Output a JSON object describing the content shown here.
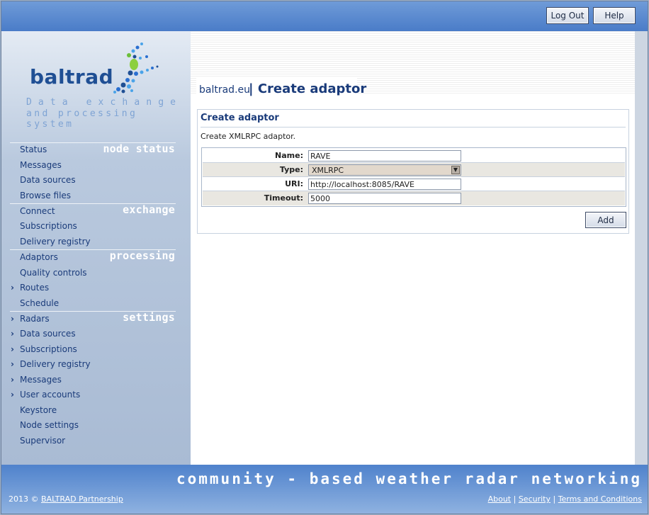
{
  "header": {
    "logout_label": "Log Out",
    "help_label": "Help"
  },
  "brand": {
    "name": "baltrad",
    "tagline_line1": "Data exchange",
    "tagline_line2": "and processing system"
  },
  "sidebar": {
    "sections": [
      {
        "title": "node status",
        "items": [
          "Status",
          "Messages",
          "Data sources",
          "Browse files"
        ]
      },
      {
        "title": "exchange",
        "items": [
          "Connect",
          "Subscriptions",
          "Delivery registry"
        ]
      },
      {
        "title": "processing",
        "items": [
          "Adaptors",
          "Quality controls",
          "Routes",
          "Schedule"
        ]
      },
      {
        "title": "settings",
        "items": [
          "Radars",
          "Data sources",
          "Subscriptions",
          "Delivery registry",
          "Messages",
          "User accounts",
          "Keystore",
          "Node settings",
          "Supervisor"
        ]
      }
    ]
  },
  "page": {
    "breadcrumb": "baltrad.eu",
    "title": "| Create adaptor"
  },
  "form": {
    "panel_title": "Create adaptor",
    "description": "Create XMLRPC adaptor.",
    "name_label": "Name:",
    "name_value": "RAVE",
    "type_label": "Type:",
    "type_value": "XMLRPC",
    "uri_label": "URI:",
    "uri_value": "http://localhost:8085/RAVE",
    "timeout_label": "Timeout:",
    "timeout_value": "5000",
    "add_label": "Add"
  },
  "footer": {
    "tagline": "community - based weather radar networking",
    "copyright_prefix": "2013 ©",
    "copyright_link": "BALTRAD Partnership",
    "links": [
      "About",
      "Security",
      "Terms and Conditions"
    ]
  }
}
